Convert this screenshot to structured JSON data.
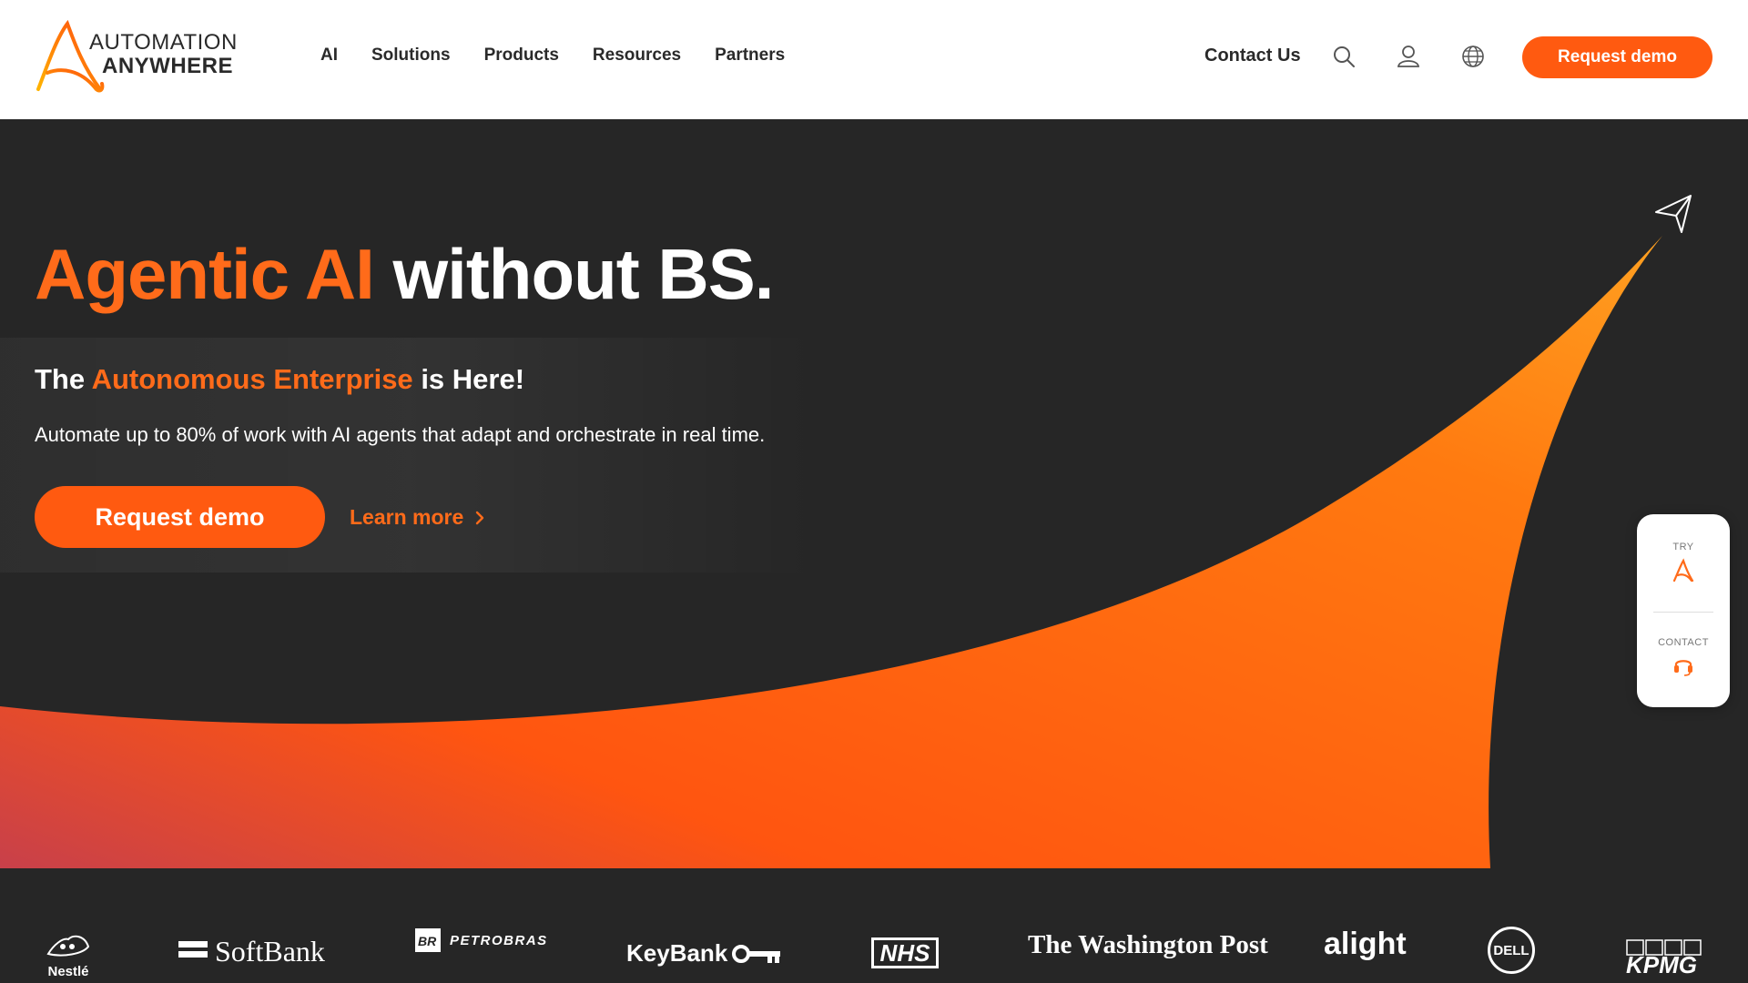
{
  "brand": {
    "line1": "AUTOMATION",
    "line2": "ANYWHERE",
    "accent": "#ff5a10"
  },
  "nav": {
    "items": [
      "AI",
      "Solutions",
      "Products",
      "Resources",
      "Partners"
    ],
    "contact": "Contact Us",
    "icons": [
      "search-icon",
      "user-icon",
      "globe-icon"
    ],
    "request_demo": "Request demo"
  },
  "hero": {
    "headline_accent": "Agentic AI",
    "headline_rest": "without BS.",
    "sub_prefix": "The",
    "sub_accent": "Autonomous Enterprise",
    "sub_suffix": "is Here!",
    "description": "Automate up to 80% of work with AI agents that adapt and orchestrate in real time.",
    "cta": "Request demo",
    "learn_more": "Learn more"
  },
  "side_widget": {
    "try_label": "TRY",
    "contact_label": "CONTACT"
  },
  "customers": [
    "Nestlé",
    "SoftBank",
    "PETROBRAS",
    "KeyBank",
    "NHS",
    "The Washington Post",
    "alight",
    "DELL",
    "KPMG"
  ]
}
